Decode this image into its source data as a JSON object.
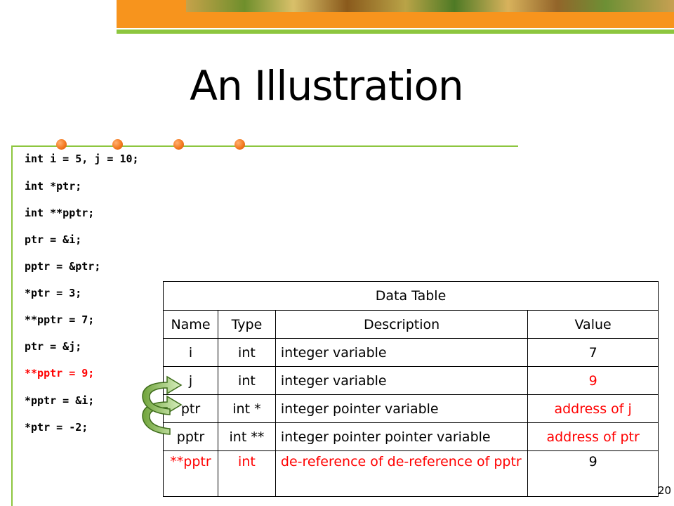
{
  "slide": {
    "title": "An Illustration",
    "page_number": "20",
    "code_lines": [
      {
        "text": "int i = 5, j = 10;",
        "highlight": false
      },
      {
        "text": "int *ptr;",
        "highlight": false
      },
      {
        "text": "int **pptr;",
        "highlight": false
      },
      {
        "text": "ptr = &i;",
        "highlight": false
      },
      {
        "text": "pptr = &ptr;",
        "highlight": false
      },
      {
        "text": "*ptr = 3;",
        "highlight": false
      },
      {
        "text": "**pptr = 7;",
        "highlight": false
      },
      {
        "text": "ptr = &j;",
        "highlight": false
      },
      {
        "text": "**pptr = 9;",
        "highlight": true
      },
      {
        "text": "*pptr = &i;",
        "highlight": false
      },
      {
        "text": "*ptr = -2;",
        "highlight": false
      }
    ],
    "table": {
      "caption": "Data Table",
      "headers": [
        "Name",
        "Type",
        "Description",
        "Value"
      ],
      "rows": [
        {
          "name": "i",
          "type": "int",
          "description": "integer variable",
          "value": "7"
        },
        {
          "name": "j",
          "type": "int",
          "description": "integer variable",
          "value": "9"
        },
        {
          "name": "ptr",
          "type": "int *",
          "description": "integer pointer variable",
          "value": "address of j"
        },
        {
          "name": "pptr",
          "type": "int **",
          "description": "integer pointer pointer variable",
          "value": "address of ptr"
        },
        {
          "name": "**pptr",
          "type": "int",
          "description": "de-reference of de-reference of pptr",
          "value": "9"
        }
      ]
    },
    "colors": {
      "accent_orange": "#f7941d",
      "accent_green": "#8dc63f",
      "highlight_red": "#ff0000"
    }
  }
}
